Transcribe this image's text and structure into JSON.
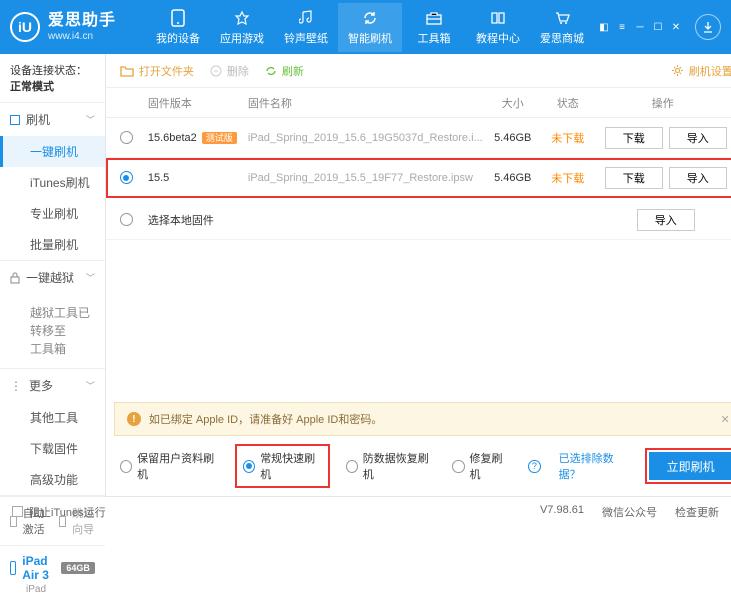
{
  "brand": {
    "name": "爱思助手",
    "url": "www.i4.cn"
  },
  "nav": [
    {
      "id": "device",
      "label": "我的设备"
    },
    {
      "id": "apps",
      "label": "应用游戏"
    },
    {
      "id": "ring",
      "label": "铃声壁纸"
    },
    {
      "id": "flash",
      "label": "智能刷机"
    },
    {
      "id": "tools",
      "label": "工具箱"
    },
    {
      "id": "tutorial",
      "label": "教程中心"
    },
    {
      "id": "mall",
      "label": "爱思商城"
    }
  ],
  "status": {
    "prefix": "设备连接状态：",
    "value": "正常模式"
  },
  "side": {
    "flash": {
      "label": "刷机",
      "items": [
        {
          "id": "one",
          "label": "一键刷机"
        },
        {
          "id": "itunes",
          "label": "iTunes刷机"
        },
        {
          "id": "pro",
          "label": "专业刷机"
        },
        {
          "id": "batch",
          "label": "批量刷机"
        }
      ]
    },
    "jailbreak": {
      "label": "一键越狱",
      "note": "越狱工具已转移至\n工具箱"
    },
    "more": {
      "label": "更多",
      "items": [
        {
          "id": "other",
          "label": "其他工具"
        },
        {
          "id": "dlfw",
          "label": "下载固件"
        },
        {
          "id": "adv",
          "label": "高级功能"
        }
      ]
    }
  },
  "side_bottom": {
    "auto": "自动激活",
    "skip": "跳过向导"
  },
  "device": {
    "name": "iPad Air 3",
    "storage": "64GB",
    "type": "iPad"
  },
  "toolbar": {
    "open": "打开文件夹",
    "del": "删除",
    "refresh": "刷新",
    "settings": "刷机设置"
  },
  "thead": {
    "ver": "固件版本",
    "name": "固件名称",
    "size": "大小",
    "stat": "状态",
    "ops": "操作"
  },
  "rows": [
    {
      "ver": "15.6beta2",
      "beta": "测试版",
      "name": "iPad_Spring_2019_15.6_19G5037d_Restore.i...",
      "size": "5.46GB",
      "stat": "未下载",
      "sel": false
    },
    {
      "ver": "15.5",
      "name": "iPad_Spring_2019_15.5_19F77_Restore.ipsw",
      "size": "5.46GB",
      "stat": "未下载",
      "sel": true
    }
  ],
  "local": "选择本地固件",
  "btn": {
    "download": "下载",
    "import": "导入"
  },
  "warn": "如已绑定 Apple ID，请准备好 Apple ID和密码。",
  "opts": {
    "keep": "保留用户资料刷机",
    "fast": "常规快速刷机",
    "recover": "防数据恢复刷机",
    "repair": "修复刷机",
    "exclude": "已选排除数据？"
  },
  "go": "立即刷机",
  "footer": {
    "block": "阻止iTunes运行",
    "ver": "V7.98.61",
    "wx": "微信公众号",
    "check": "检查更新"
  }
}
